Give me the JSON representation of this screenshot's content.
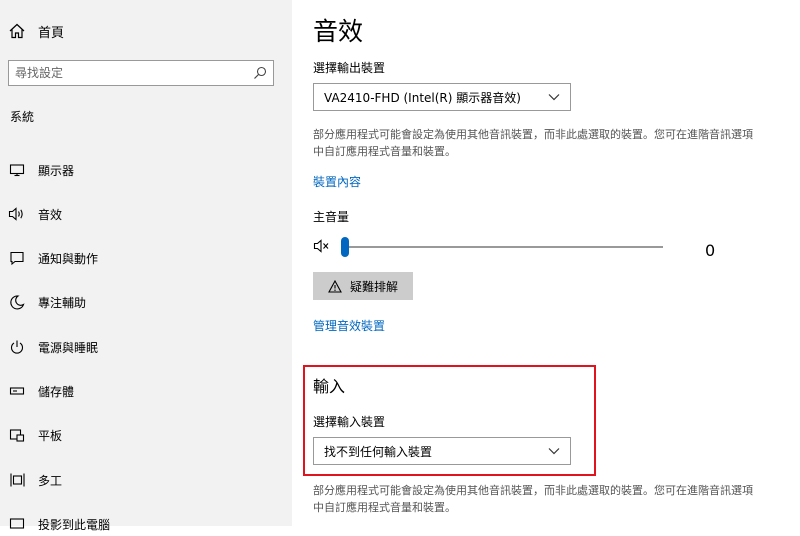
{
  "sidebar": {
    "home_label": "首頁",
    "search_placeholder": "尋找設定",
    "section_label": "系統",
    "items": [
      {
        "label": "顯示器",
        "icon": "monitor-icon"
      },
      {
        "label": "音效",
        "icon": "speaker-icon"
      },
      {
        "label": "通知與動作",
        "icon": "notification-icon"
      },
      {
        "label": "專注輔助",
        "icon": "moon-icon"
      },
      {
        "label": "電源與睡眠",
        "icon": "power-icon"
      },
      {
        "label": "儲存體",
        "icon": "storage-icon"
      },
      {
        "label": "平板",
        "icon": "tablet-icon"
      },
      {
        "label": "多工",
        "icon": "multitasking-icon"
      },
      {
        "label": "投影到此電腦",
        "icon": "projector-icon"
      }
    ]
  },
  "main": {
    "title": "音效",
    "output": {
      "label": "選擇輸出裝置",
      "selected": "VA2410-FHD (Intel(R) 顯示器音效)",
      "description": "部分應用程式可能會設定為使用其他音訊裝置，而非此處選取的裝置。您可在進階音訊選項中自訂應用程式音量和裝置。",
      "properties_link": "裝置內容",
      "volume_label": "主音量",
      "volume_value": "0",
      "volume_level": 0,
      "troubleshoot_label": "疑難排解",
      "manage_link": "管理音效裝置"
    },
    "input": {
      "title": "輸入",
      "label": "選擇輸入裝置",
      "selected": "找不到任何輸入裝置",
      "description": "部分應用程式可能會設定為使用其他音訊裝置，而非此處選取的裝置。您可在進階音訊選項中自訂應用程式音量和裝置。"
    }
  },
  "colors": {
    "accent": "#0067c0",
    "highlight": "#e0141e",
    "sidebar_bg": "#f2f2f2"
  }
}
